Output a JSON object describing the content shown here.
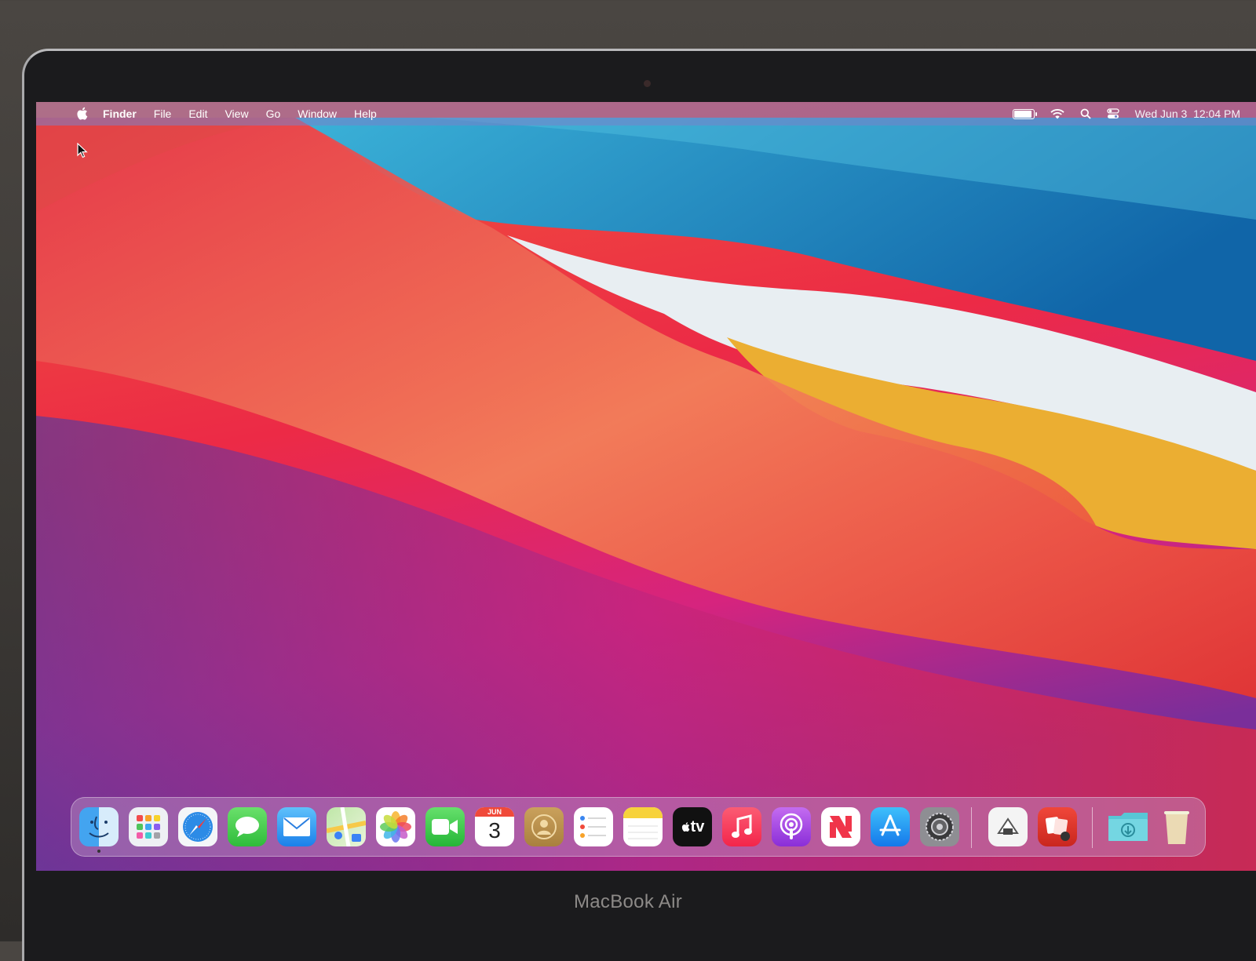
{
  "device": {
    "model_label": "MacBook Air"
  },
  "menubar": {
    "app_name": "Finder",
    "menus": [
      "File",
      "Edit",
      "View",
      "Go",
      "Window",
      "Help"
    ],
    "status": {
      "datetime": "Wed Jun 3  12:04 PM"
    }
  },
  "dock": {
    "apps": [
      {
        "name": "finder-icon"
      },
      {
        "name": "launchpad-icon"
      },
      {
        "name": "safari-icon"
      },
      {
        "name": "messages-icon"
      },
      {
        "name": "mail-icon"
      },
      {
        "name": "maps-icon"
      },
      {
        "name": "photos-icon"
      },
      {
        "name": "facetime-icon"
      },
      {
        "name": "calendar-icon",
        "month": "JUN",
        "day": "3"
      },
      {
        "name": "contacts-icon"
      },
      {
        "name": "reminders-icon"
      },
      {
        "name": "notes-icon"
      },
      {
        "name": "tv-icon",
        "label": "tv"
      },
      {
        "name": "music-icon"
      },
      {
        "name": "podcasts-icon"
      },
      {
        "name": "news-icon"
      },
      {
        "name": "app-store-icon"
      },
      {
        "name": "system-preferences-icon"
      },
      {
        "name": "migration-assistant-icon"
      },
      {
        "name": "photo-booth-icon"
      },
      {
        "name": "downloads-folder-icon"
      },
      {
        "name": "trash-icon"
      }
    ]
  },
  "colors": {
    "wallpaper_red": "#e8213f",
    "wallpaper_orange": "#f07850",
    "wallpaper_yellow": "#e9a52e",
    "wallpaper_blue": "#1e9fd0",
    "wallpaper_magenta": "#d4247e",
    "menubar_tint": "#7882c8"
  }
}
